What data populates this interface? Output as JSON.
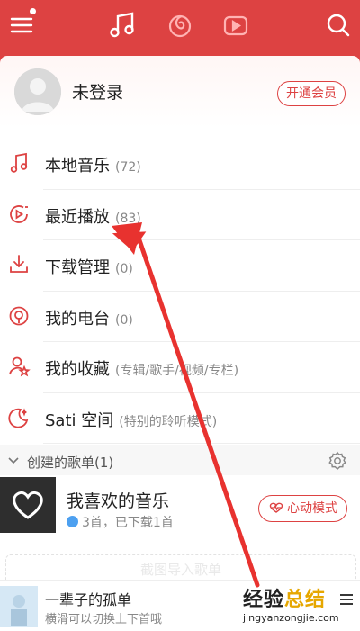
{
  "topbar": {
    "icons": [
      "menu-icon",
      "music-note-icon",
      "netease-radio-icon",
      "video-play-icon",
      "search-icon"
    ]
  },
  "profile": {
    "login_text": "未登录",
    "vip_button": "开通会员"
  },
  "menu": {
    "items": [
      {
        "icon": "music-note-icon",
        "label": "本地音乐",
        "count": "(72)"
      },
      {
        "icon": "recent-play-icon",
        "label": "最近播放",
        "count": "(83)"
      },
      {
        "icon": "download-icon",
        "label": "下载管理",
        "count": "(0)"
      },
      {
        "icon": "radio-icon",
        "label": "我的电台",
        "count": "(0)"
      },
      {
        "icon": "collect-icon",
        "label": "我的收藏",
        "count": "(专辑/歌手/视频/专栏)"
      },
      {
        "icon": "sati-icon",
        "label": "Sati 空间",
        "count": "(特别的聆听模式)"
      }
    ]
  },
  "created_playlists": {
    "title": "创建的歌单(1)",
    "playlist": {
      "title": "我喜欢的音乐",
      "subtitle": "3首，已下载1首",
      "heartbeat_button": "心动模式"
    },
    "import_hint": "截图导入歌单"
  },
  "mini_player": {
    "song_title": "一辈子的孤单",
    "hint": "横滑可以切换上下首哦"
  },
  "watermark": {
    "part1": "经验",
    "part2": "总结",
    "url": "jingyanzongjie.com"
  },
  "colors": {
    "accent": "#dd4242",
    "annotation_arrow": "#e8322f"
  }
}
